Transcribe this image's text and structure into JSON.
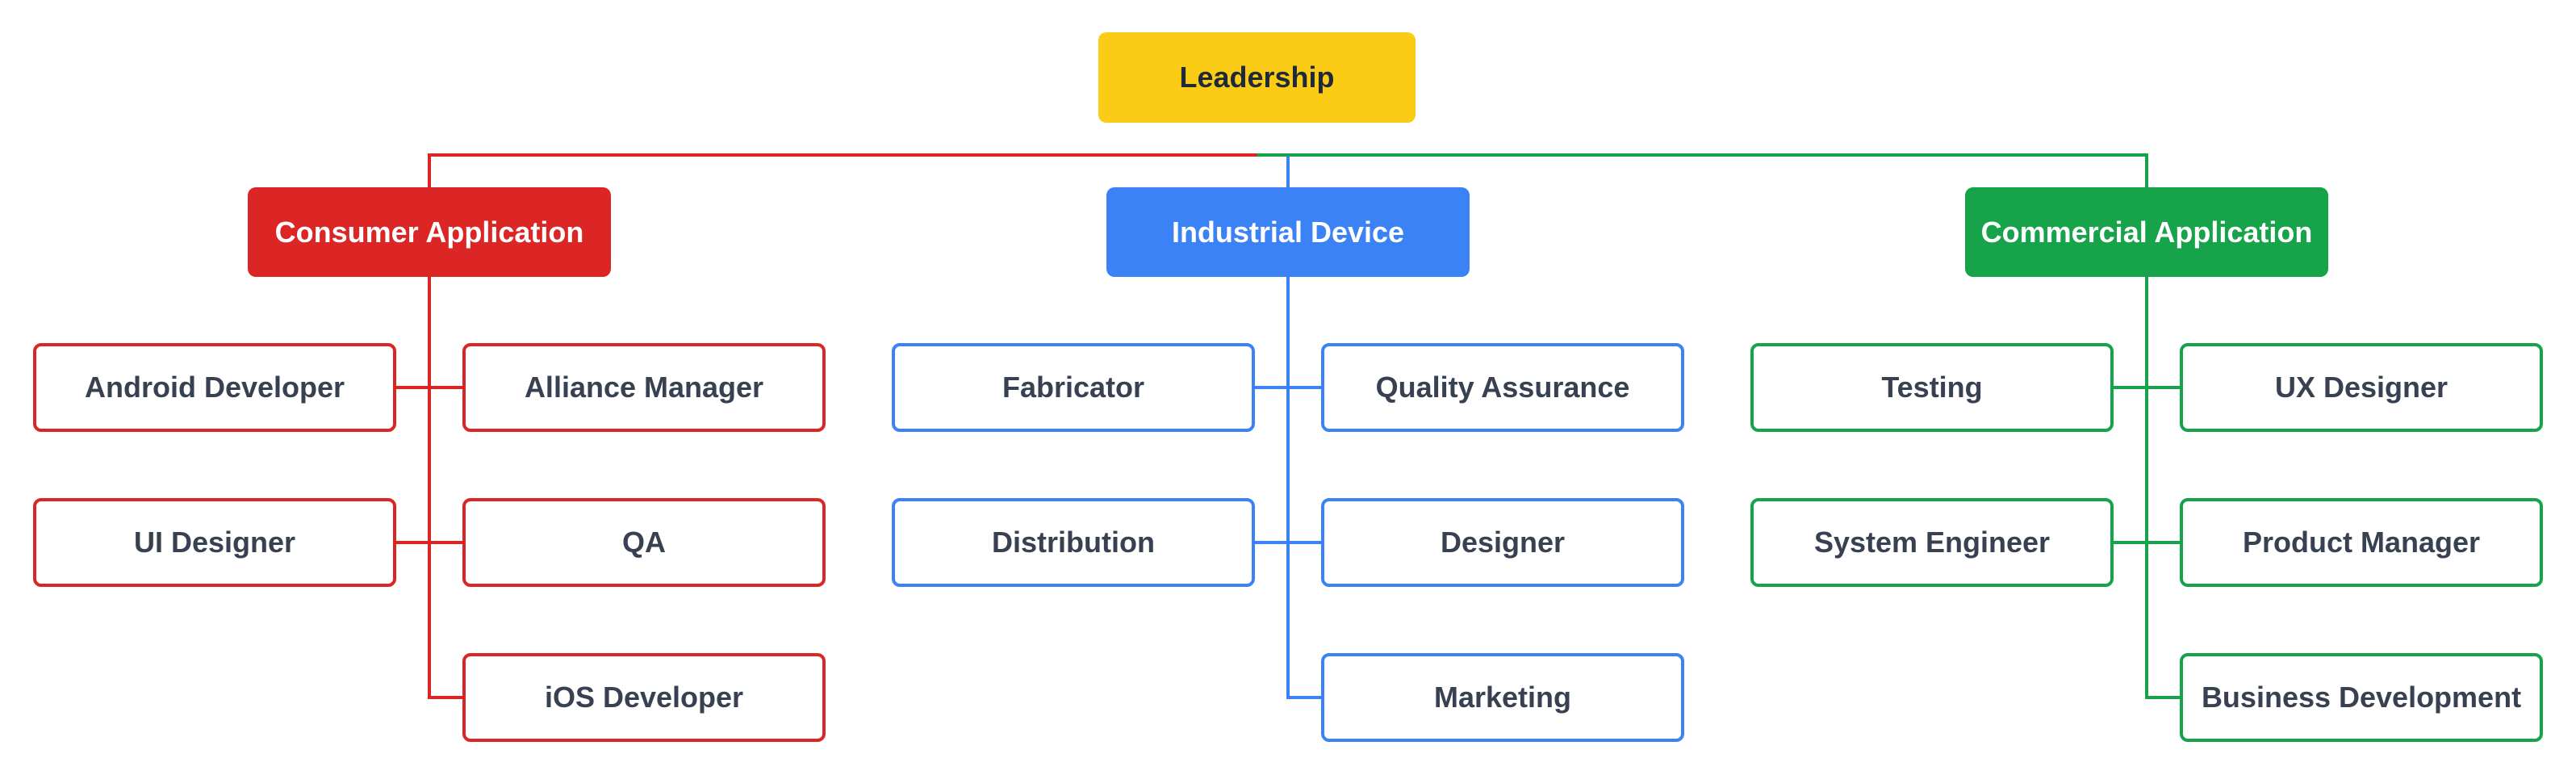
{
  "chart": {
    "root": {
      "label": "Leadership",
      "color": "#facc15"
    },
    "departments": [
      {
        "label": "Consumer Application",
        "color": "#dc2626",
        "children": [
          [
            "Android Developer",
            "Alliance Manager"
          ],
          [
            "UI Designer",
            "QA"
          ],
          [
            null,
            "iOS Developer"
          ]
        ]
      },
      {
        "label": "Industrial Device",
        "color": "#3b82f6",
        "children": [
          [
            "Fabricator",
            "Quality Assurance"
          ],
          [
            "Distribution",
            "Designer"
          ],
          [
            null,
            "Marketing"
          ]
        ]
      },
      {
        "label": "Commercial Application",
        "color": "#16a34a",
        "children": [
          [
            "Testing",
            "UX Designer"
          ],
          [
            "System Engineer",
            "Product Manager"
          ],
          [
            null,
            "Business Development"
          ]
        ]
      }
    ]
  }
}
